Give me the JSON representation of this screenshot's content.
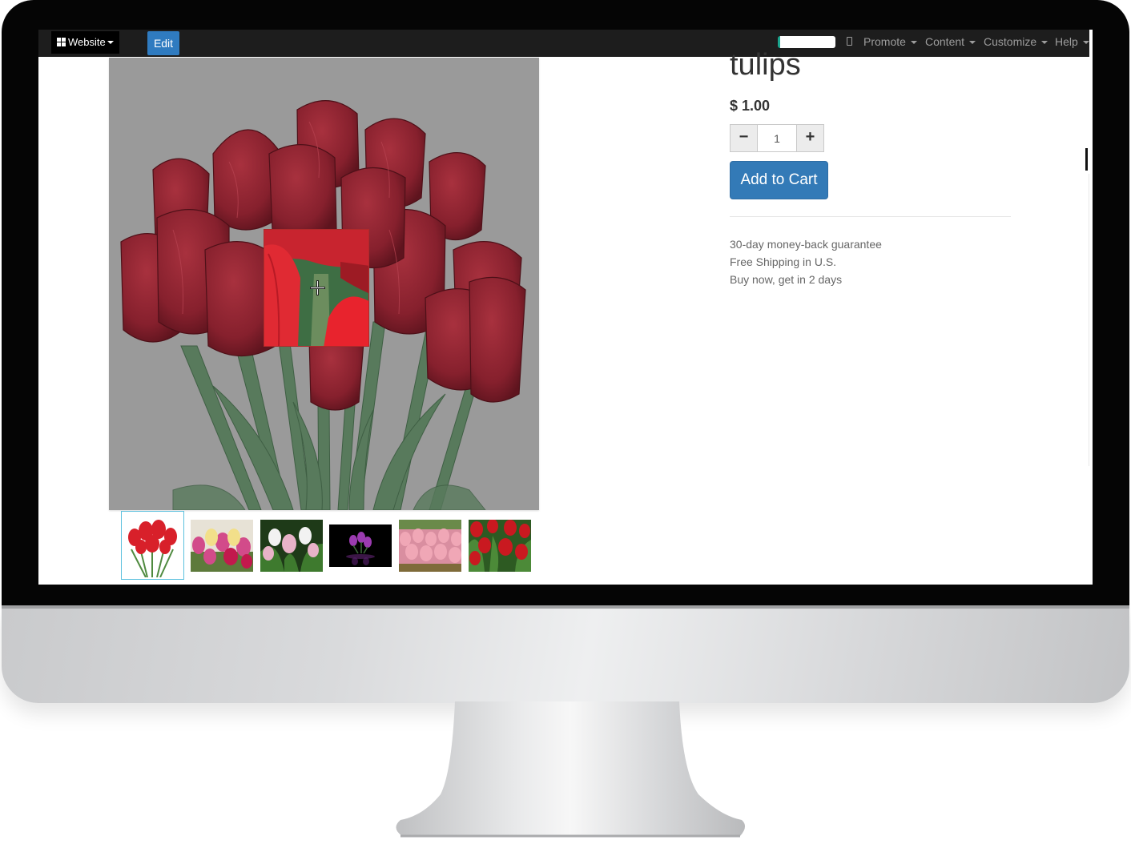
{
  "navbar": {
    "website_label": "Website",
    "edit_label": "Edit",
    "menus": [
      {
        "label": "Promote"
      },
      {
        "label": "Content"
      },
      {
        "label": "Customize"
      },
      {
        "label": "Help"
      }
    ]
  },
  "product": {
    "title": "tulips",
    "price": "$ 1.00",
    "quantity": "1",
    "add_to_cart_label": "Add to Cart",
    "benefits": [
      "30-day money-back guarantee",
      "Free Shipping in U.S.",
      "Buy now, get in 2 days"
    ]
  },
  "thumbnails": [
    {
      "icon": "red-tulip-bouquet-thumbnail",
      "selected": true
    },
    {
      "icon": "pink-yellow-tulips-thumbnail",
      "selected": false
    },
    {
      "icon": "white-pink-tulips-thumbnail",
      "selected": false
    },
    {
      "icon": "purple-tulip-black-thumbnail",
      "selected": false
    },
    {
      "icon": "pink-tulip-field-thumbnail",
      "selected": false
    },
    {
      "icon": "red-tulip-field-thumbnail",
      "selected": false
    }
  ],
  "colors": {
    "navbar": "#1d1d1d",
    "edit_button": "#2f7bc0",
    "add_to_cart": "#337ab7",
    "tulip_red": "#8b1f2c",
    "image_background": "#9a9a9a"
  }
}
